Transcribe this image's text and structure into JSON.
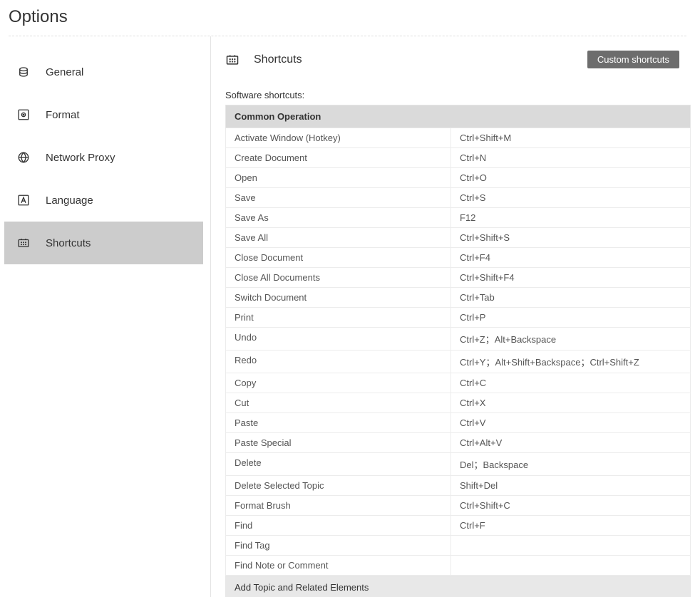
{
  "page": {
    "title": "Options"
  },
  "sidebar": {
    "items": [
      {
        "label": "General"
      },
      {
        "label": "Format"
      },
      {
        "label": "Network Proxy"
      },
      {
        "label": "Language"
      },
      {
        "label": "Shortcuts"
      }
    ]
  },
  "content": {
    "title": "Shortcuts",
    "customBtn": "Custom shortcuts",
    "sectionLabel": "Software shortcuts:",
    "groups": [
      {
        "name": "Common Operation",
        "rows": [
          {
            "action": "Activate Window (Hotkey)",
            "key": "Ctrl+Shift+M"
          },
          {
            "action": "Create Document",
            "key": "Ctrl+N"
          },
          {
            "action": "Open",
            "key": "Ctrl+O"
          },
          {
            "action": "Save",
            "key": "Ctrl+S"
          },
          {
            "action": "Save As",
            "key": "F12"
          },
          {
            "action": "Save All",
            "key": "Ctrl+Shift+S"
          },
          {
            "action": "Close Document",
            "key": "Ctrl+F4"
          },
          {
            "action": "Close All Documents",
            "key": "Ctrl+Shift+F4"
          },
          {
            "action": "Switch Document",
            "key": "Ctrl+Tab"
          },
          {
            "action": "Print",
            "key": "Ctrl+P"
          },
          {
            "action": "Undo",
            "key": "Ctrl+Z；Alt+Backspace"
          },
          {
            "action": "Redo",
            "key": "Ctrl+Y；Alt+Shift+Backspace；Ctrl+Shift+Z"
          },
          {
            "action": "Copy",
            "key": "Ctrl+C"
          },
          {
            "action": "Cut",
            "key": "Ctrl+X"
          },
          {
            "action": "Paste",
            "key": "Ctrl+V"
          },
          {
            "action": "Paste Special",
            "key": "Ctrl+Alt+V"
          },
          {
            "action": "Delete",
            "key": "Del；Backspace"
          },
          {
            "action": "Delete Selected Topic",
            "key": "Shift+Del"
          },
          {
            "action": "Format Brush",
            "key": "Ctrl+Shift+C"
          },
          {
            "action": "Find",
            "key": "Ctrl+F"
          },
          {
            "action": "Find Tag",
            "key": ""
          },
          {
            "action": "Find Note or Comment",
            "key": ""
          }
        ]
      },
      {
        "name": "Add Topic and Related Elements",
        "rows": []
      }
    ]
  }
}
